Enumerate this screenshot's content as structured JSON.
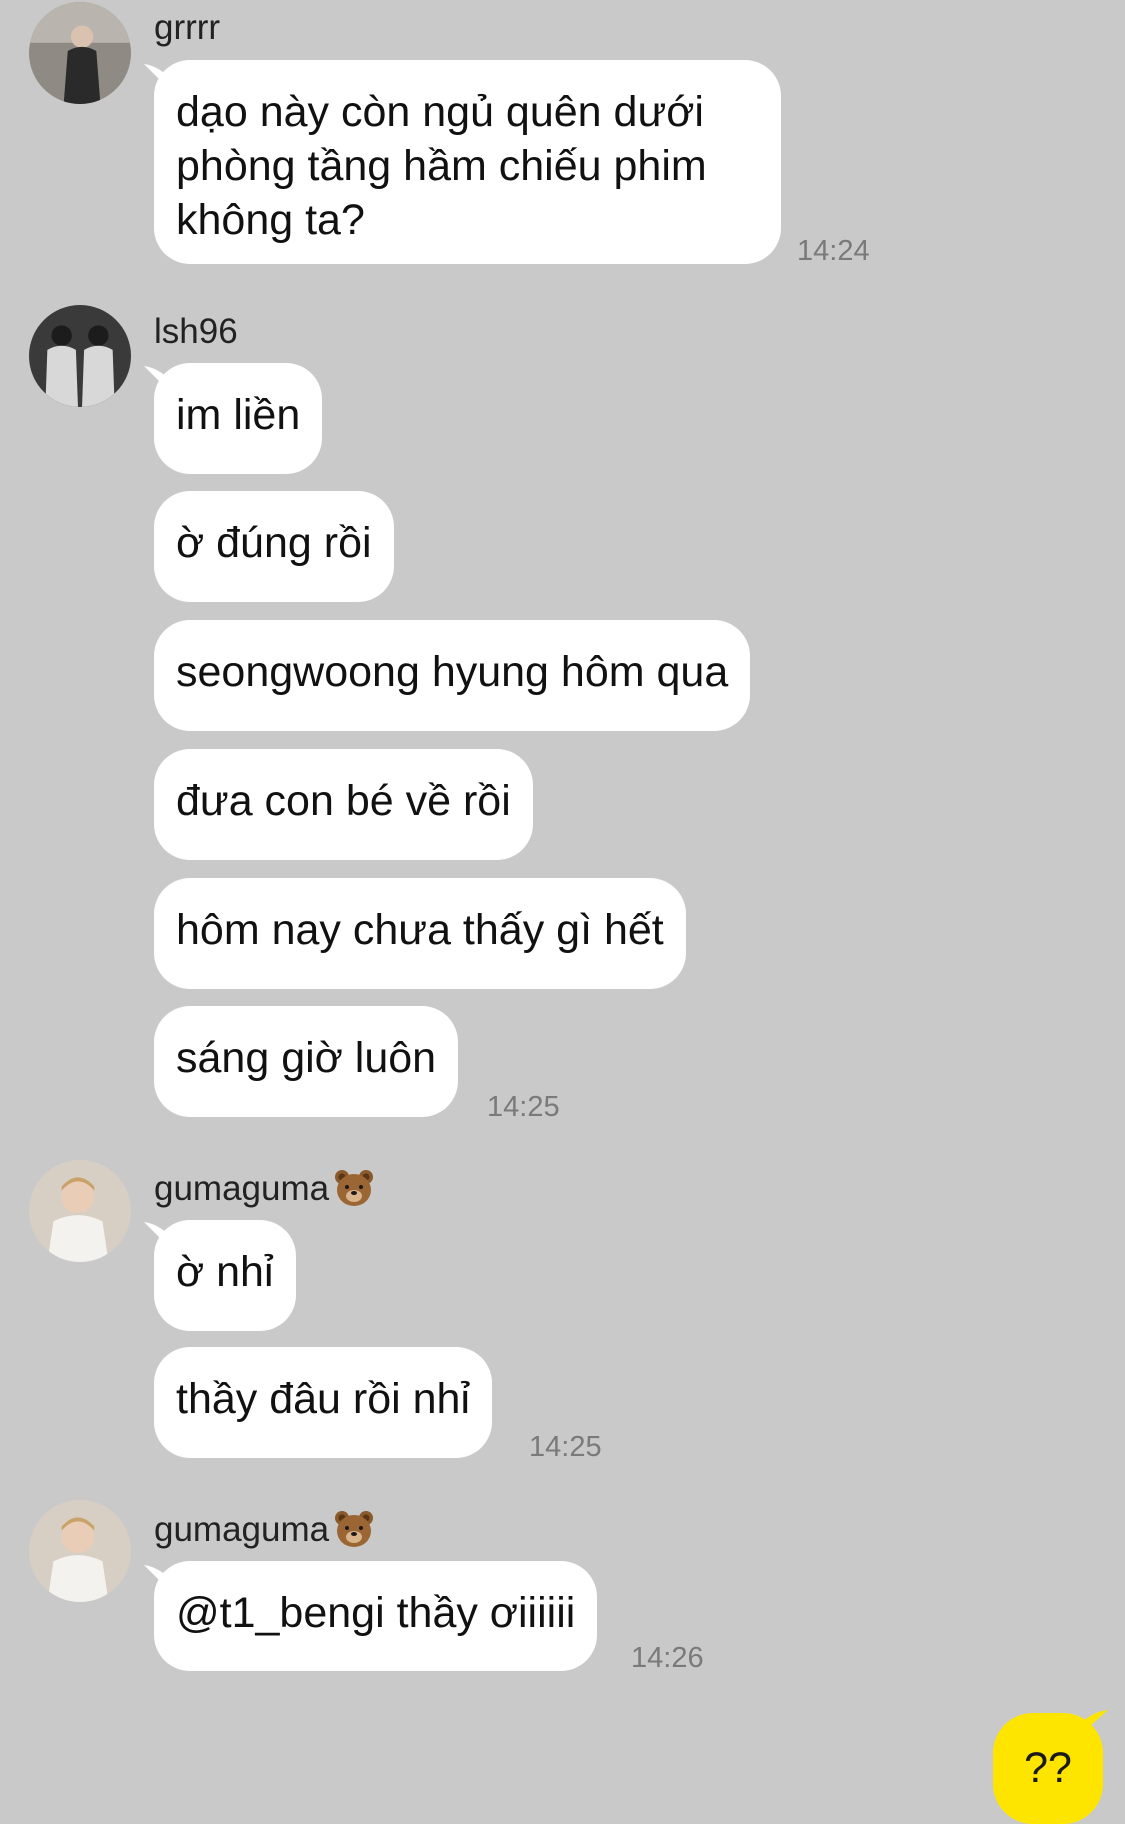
{
  "colors": {
    "background": "#c9c9c9",
    "incoming_bubble": "#ffffff",
    "outgoing_bubble": "#fee500",
    "timestamp": "#7a7a7a"
  },
  "groups": [
    {
      "sender": "grrrr",
      "avatar_icon": "user-avatar-icon",
      "messages": [
        "dạo này còn ngủ quên dưới phòng tầng hầm chiếu phim không ta?"
      ],
      "time": "14:24"
    },
    {
      "sender": "lsh96",
      "avatar_icon": "user-avatar-icon",
      "messages": [
        "im liền",
        "ờ đúng rồi",
        "seongwoong hyung hôm qua",
        "đưa con bé về rồi",
        "hôm nay chưa thấy gì hết",
        "sáng giờ luôn"
      ],
      "time": "14:25"
    },
    {
      "sender": "gumaguma",
      "sender_emoji_icon": "bear-face-icon",
      "avatar_icon": "user-avatar-icon",
      "messages": [
        "ờ nhỉ",
        "thầy đâu rồi nhỉ"
      ],
      "time": "14:25"
    },
    {
      "sender": "gumaguma",
      "sender_emoji_icon": "bear-face-icon",
      "avatar_icon": "user-avatar-icon",
      "messages": [
        "@t1_bengi thầy ơiiiiii"
      ],
      "time": "14:26"
    }
  ],
  "outgoing": {
    "message": "??"
  }
}
